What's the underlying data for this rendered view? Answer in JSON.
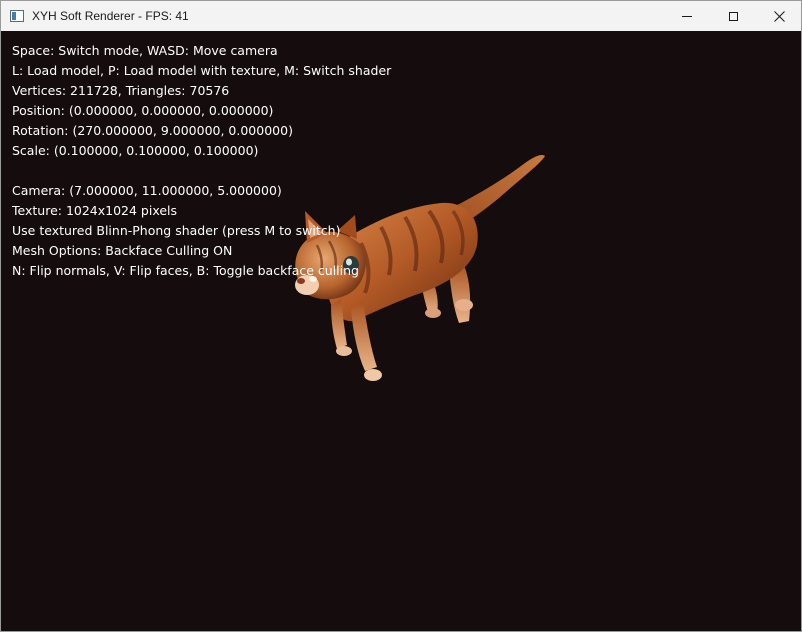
{
  "window": {
    "title": "XYH Soft Renderer - FPS: 41",
    "icon": "app-window-icon",
    "controls": [
      "minimize-icon",
      "maximize-icon",
      "close-icon"
    ]
  },
  "viewport": {
    "background": "#150d0d",
    "model": "textured-cat-model",
    "overlay_lines": [
      "Space: Switch mode, WASD: Move camera",
      "L: Load model, P: Load model with texture, M: Switch shader",
      "Vertices: 211728, Triangles: 70576",
      "Position: (0.000000, 0.000000, 0.000000)",
      "Rotation: (270.000000, 9.000000, 0.000000)",
      "Scale: (0.100000, 0.100000, 0.100000)",
      "",
      "Camera: (7.000000, 11.000000, 5.000000)",
      "Texture: 1024x1024 pixels",
      "Use textured Blinn-Phong shader (press M to switch)",
      "Mesh Options: Backface Culling ON",
      "N: Flip normals, V: Flip faces, B: Toggle backface culling"
    ]
  }
}
